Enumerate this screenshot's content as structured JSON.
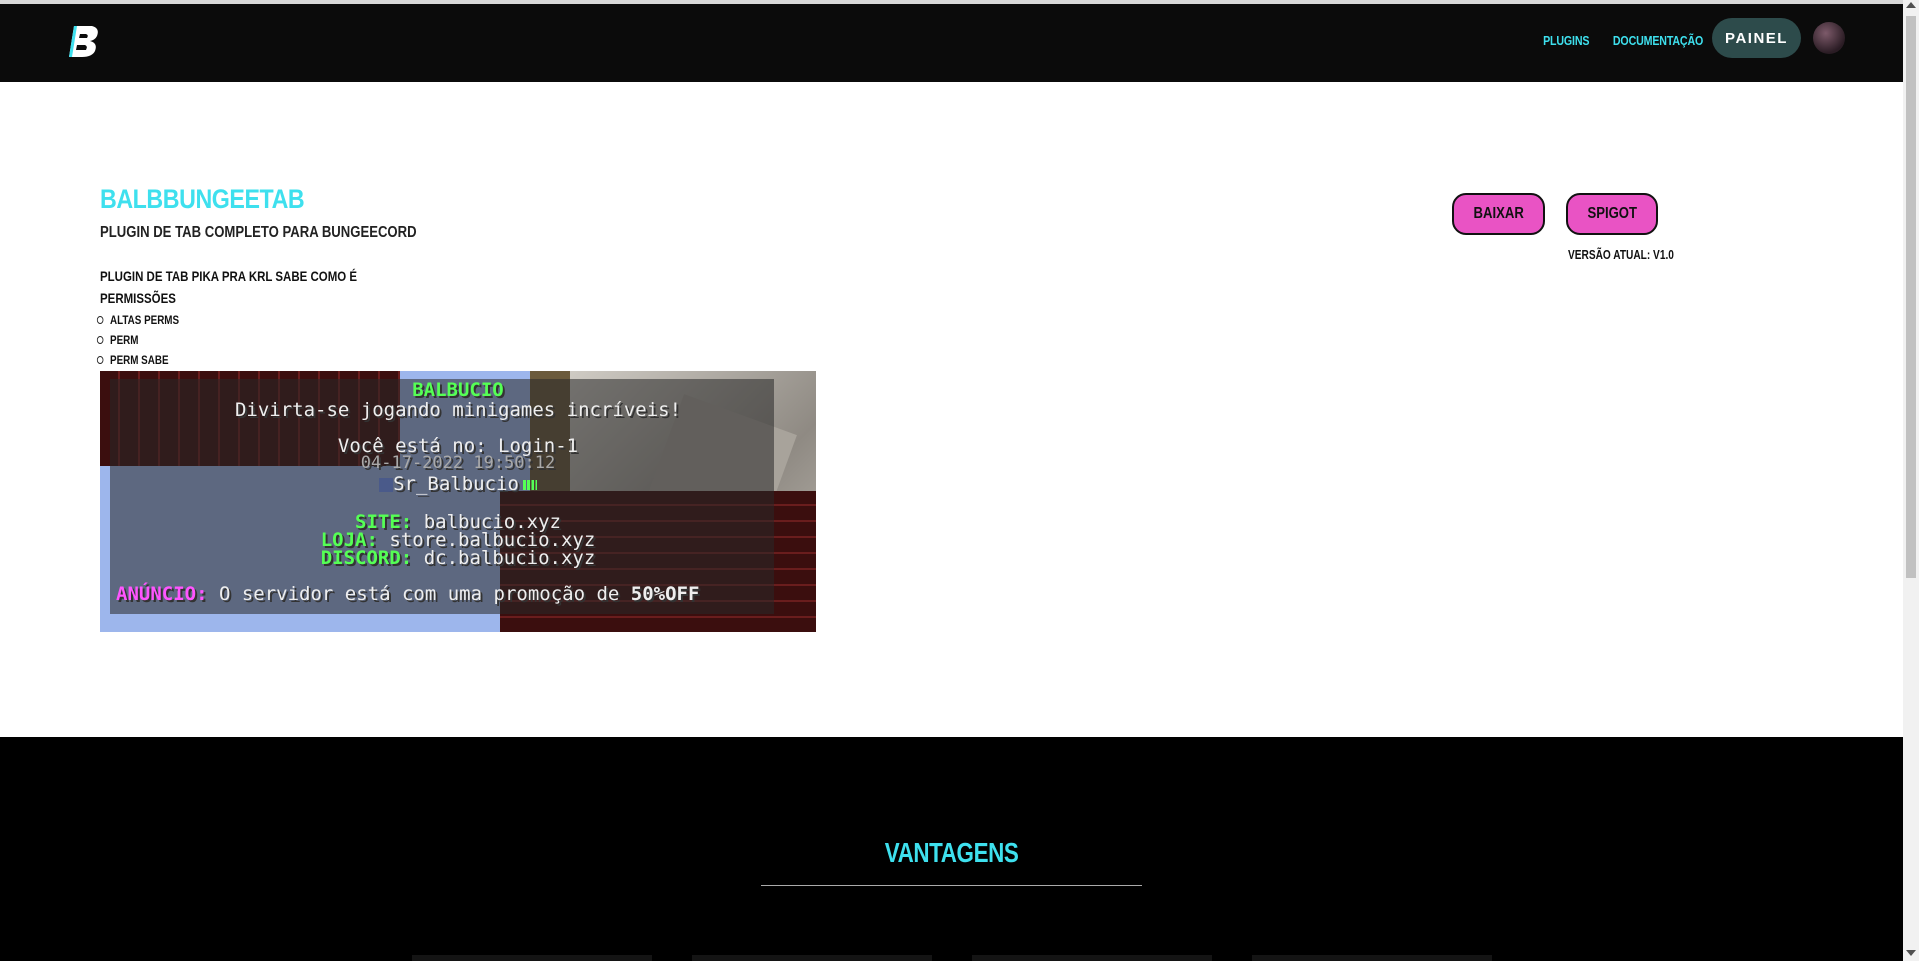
{
  "navbar": {
    "logo_icon": "b-logo-icon",
    "links": [
      "PLUGINS",
      "DOCUMENTAÇÃO"
    ],
    "painel_label": "PAINEL",
    "accent_color": "#3ee0ee",
    "background": "#0b0b0b"
  },
  "plugin": {
    "title": "BALBBUNGEETAB",
    "subtitle": "PLUGIN DE TAB COMPLETO PARA BUNGEECORD",
    "description": "PLUGIN DE TAB PIKA PRA KRL SABE COMO É",
    "permissions_heading": "PERMISSÕES",
    "permissions": [
      "ALTAS PERMS",
      "PERM",
      "PERM SABE"
    ],
    "download_label": "BAIXAR",
    "spigot_label": "SPIGOT",
    "version_label": "VERSÃO ATUAL: V1.0",
    "button_color": "#e953c4"
  },
  "preview": {
    "server_name": "BALBUCIO",
    "tagline": "Divirta-se jogando minigames incríveis!",
    "location": "Você está no: Login-1",
    "datetime": "04-17-2022 19:50:12",
    "player": "Sr_Balbucio",
    "site_label": "SITE:",
    "site_value": "balbucio.xyz",
    "loja_label": "LOJA:",
    "loja_value": "store.balbucio.xyz",
    "discord_label": "DISCORD:",
    "discord_value": "dc.balbucio.xyz",
    "announce_label": "ANÚNCIO:",
    "announce_text": "O servidor está com uma promoção de",
    "announce_highlight": "50%OFF"
  },
  "section": {
    "title": "VANTAGENS"
  }
}
